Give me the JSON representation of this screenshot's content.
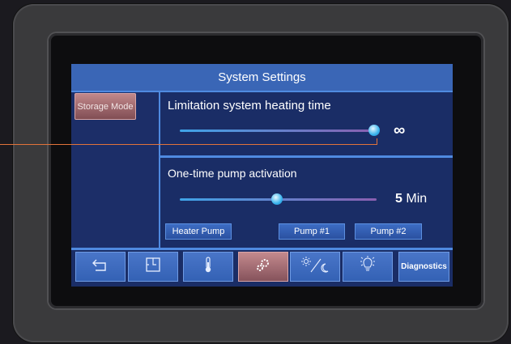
{
  "screen": {
    "title": "System Settings"
  },
  "sidebar": {
    "mode_button": "Storage Mode"
  },
  "heating": {
    "label": "Limitation system heating time",
    "value_text": "∞",
    "slider_fraction": 1.0
  },
  "pump": {
    "label": "One-time pump activation",
    "value": "5",
    "unit": "Min",
    "slider_fraction": 0.5
  },
  "pump_buttons": [
    "Heater Pump",
    "Pump #1",
    "Pump #2"
  ],
  "nav": {
    "items": [
      {
        "icon": "back-arrow-icon"
      },
      {
        "icon": "schedule-icon"
      },
      {
        "icon": "thermometer-icon"
      },
      {
        "icon": "gears-icon",
        "active": true
      },
      {
        "icon": "day-night-icon"
      },
      {
        "icon": "light-bulb-icon"
      },
      {
        "label": "Diagnostics"
      }
    ]
  },
  "colors": {
    "accent": "#3a66b6",
    "active": "#c48a8c",
    "pointer": "#e2733a"
  }
}
